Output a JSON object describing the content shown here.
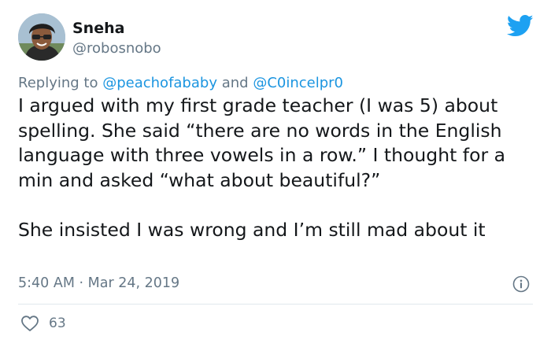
{
  "tweet": {
    "author": {
      "name": "Sneha",
      "handle": "@robosnobo"
    },
    "reply": {
      "prefix": "Replying to",
      "mention_1": "@peachofababy",
      "connector": "and",
      "mention_2": "@C0incelpr0"
    },
    "paragraph_1": "I argued with my first grade teacher (I was 5) about spelling. She said “there are no words in the English language with three vowels in a row.” I thought for a min and asked “what about beautiful?”",
    "paragraph_2": "She insisted I was wrong and I’m still mad about it",
    "timestamp": "5:40 AM · Mar 24, 2019",
    "likes": "63"
  },
  "icons": {
    "logo": "twitter-bird-icon",
    "info": "info-icon",
    "like": "heart-icon"
  },
  "colors": {
    "brand": "#1da1f2",
    "mention": "#1b95e0",
    "secondary_text": "#657786",
    "primary_text": "#14171a"
  }
}
